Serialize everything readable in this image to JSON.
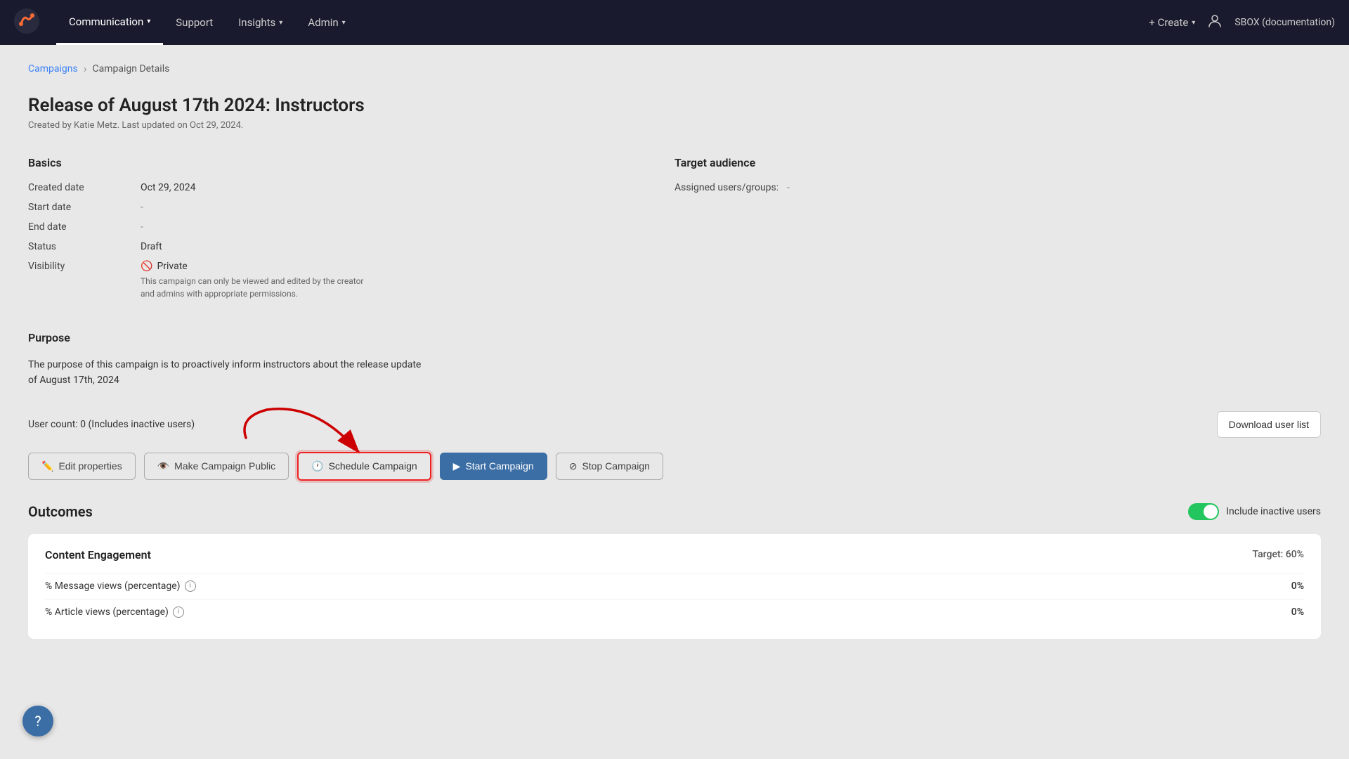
{
  "nav": {
    "logo_alt": "App Logo",
    "items": [
      {
        "id": "communication",
        "label": "Communication",
        "active": true,
        "has_dropdown": true
      },
      {
        "id": "support",
        "label": "Support",
        "active": false,
        "has_dropdown": false
      },
      {
        "id": "insights",
        "label": "Insights",
        "active": false,
        "has_dropdown": true
      },
      {
        "id": "admin",
        "label": "Admin",
        "active": false,
        "has_dropdown": true
      }
    ],
    "create_label": "+ Create",
    "org_label": "SBOX (documentation)"
  },
  "breadcrumb": {
    "parent_label": "Campaigns",
    "separator": "›",
    "current_label": "Campaign Details"
  },
  "page": {
    "title": "Release of August 17th 2024: Instructors",
    "subtitle": "Created by Katie Metz. Last updated on Oct 29, 2024."
  },
  "basics": {
    "section_title": "Basics",
    "fields": [
      {
        "label": "Created date",
        "value": "Oct 29, 2024"
      },
      {
        "label": "Start date",
        "value": "-"
      },
      {
        "label": "End date",
        "value": "-"
      },
      {
        "label": "Status",
        "value": "Draft"
      },
      {
        "label": "Visibility",
        "value": "Private",
        "is_private": true
      }
    ],
    "private_note": "This campaign can only be viewed and edited by the creator and admins with appropriate permissions."
  },
  "target_audience": {
    "section_title": "Target audience",
    "assigned_label": "Assigned users/groups:",
    "assigned_value": "-"
  },
  "purpose": {
    "section_title": "Purpose",
    "text": "The purpose of this campaign is to proactively inform instructors about the release update of August 17th, 2024"
  },
  "user_count": {
    "text": "User count: 0 (Includes inactive users)"
  },
  "actions": {
    "edit_label": "Edit properties",
    "make_public_label": "Make Campaign Public",
    "schedule_label": "Schedule Campaign",
    "start_label": "Start Campaign",
    "stop_label": "Stop Campaign",
    "download_label": "Download user list"
  },
  "outcomes": {
    "section_title": "Outcomes",
    "toggle_label": "Include inactive users",
    "engagement_title": "Content Engagement",
    "target_label": "Target: 60%",
    "metrics": [
      {
        "label": "% Message views (percentage)",
        "value": "0%",
        "has_info": true
      },
      {
        "label": "% Article views (percentage)",
        "value": "0%",
        "has_info": true
      }
    ]
  },
  "help": {
    "icon": "?"
  }
}
